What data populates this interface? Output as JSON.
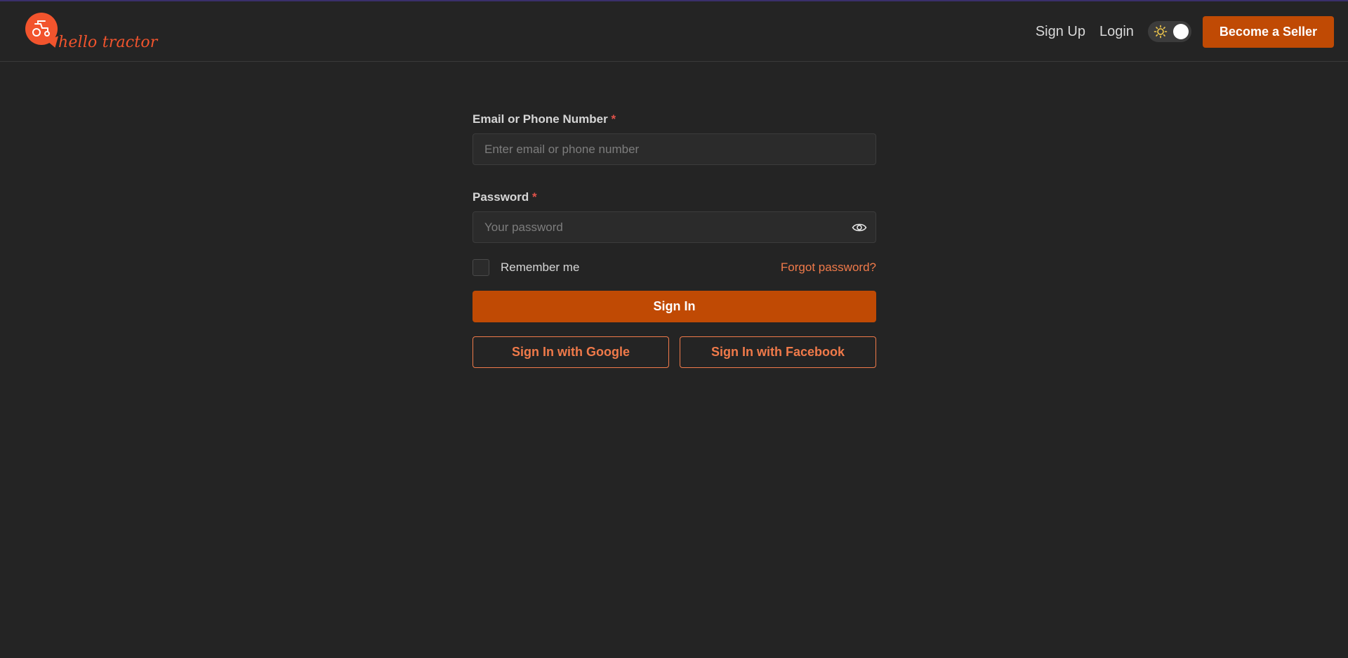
{
  "brand": {
    "logo_text": "hello tractor",
    "color": "#f2542d"
  },
  "nav": {
    "signup_label": "Sign Up",
    "login_label": "Login",
    "theme_toggle": {
      "icon": "sun-icon",
      "state": "light"
    },
    "seller_label": "Become a Seller"
  },
  "form": {
    "email": {
      "label": "Email or Phone Number",
      "required_mark": "*",
      "placeholder": "Enter email or phone number",
      "value": ""
    },
    "password": {
      "label": "Password",
      "required_mark": "*",
      "placeholder": "Your password",
      "value": "",
      "toggle_icon": "eye-icon"
    },
    "remember_label": "Remember me",
    "remember_checked": false,
    "forgot_label": "Forgot password?",
    "signin_label": "Sign In",
    "google_label": "Sign In with Google",
    "facebook_label": "Sign In with Facebook"
  },
  "colors": {
    "accent": "#c04a04",
    "link": "#f07a4a",
    "background": "#242424",
    "required": "#e0524a"
  }
}
